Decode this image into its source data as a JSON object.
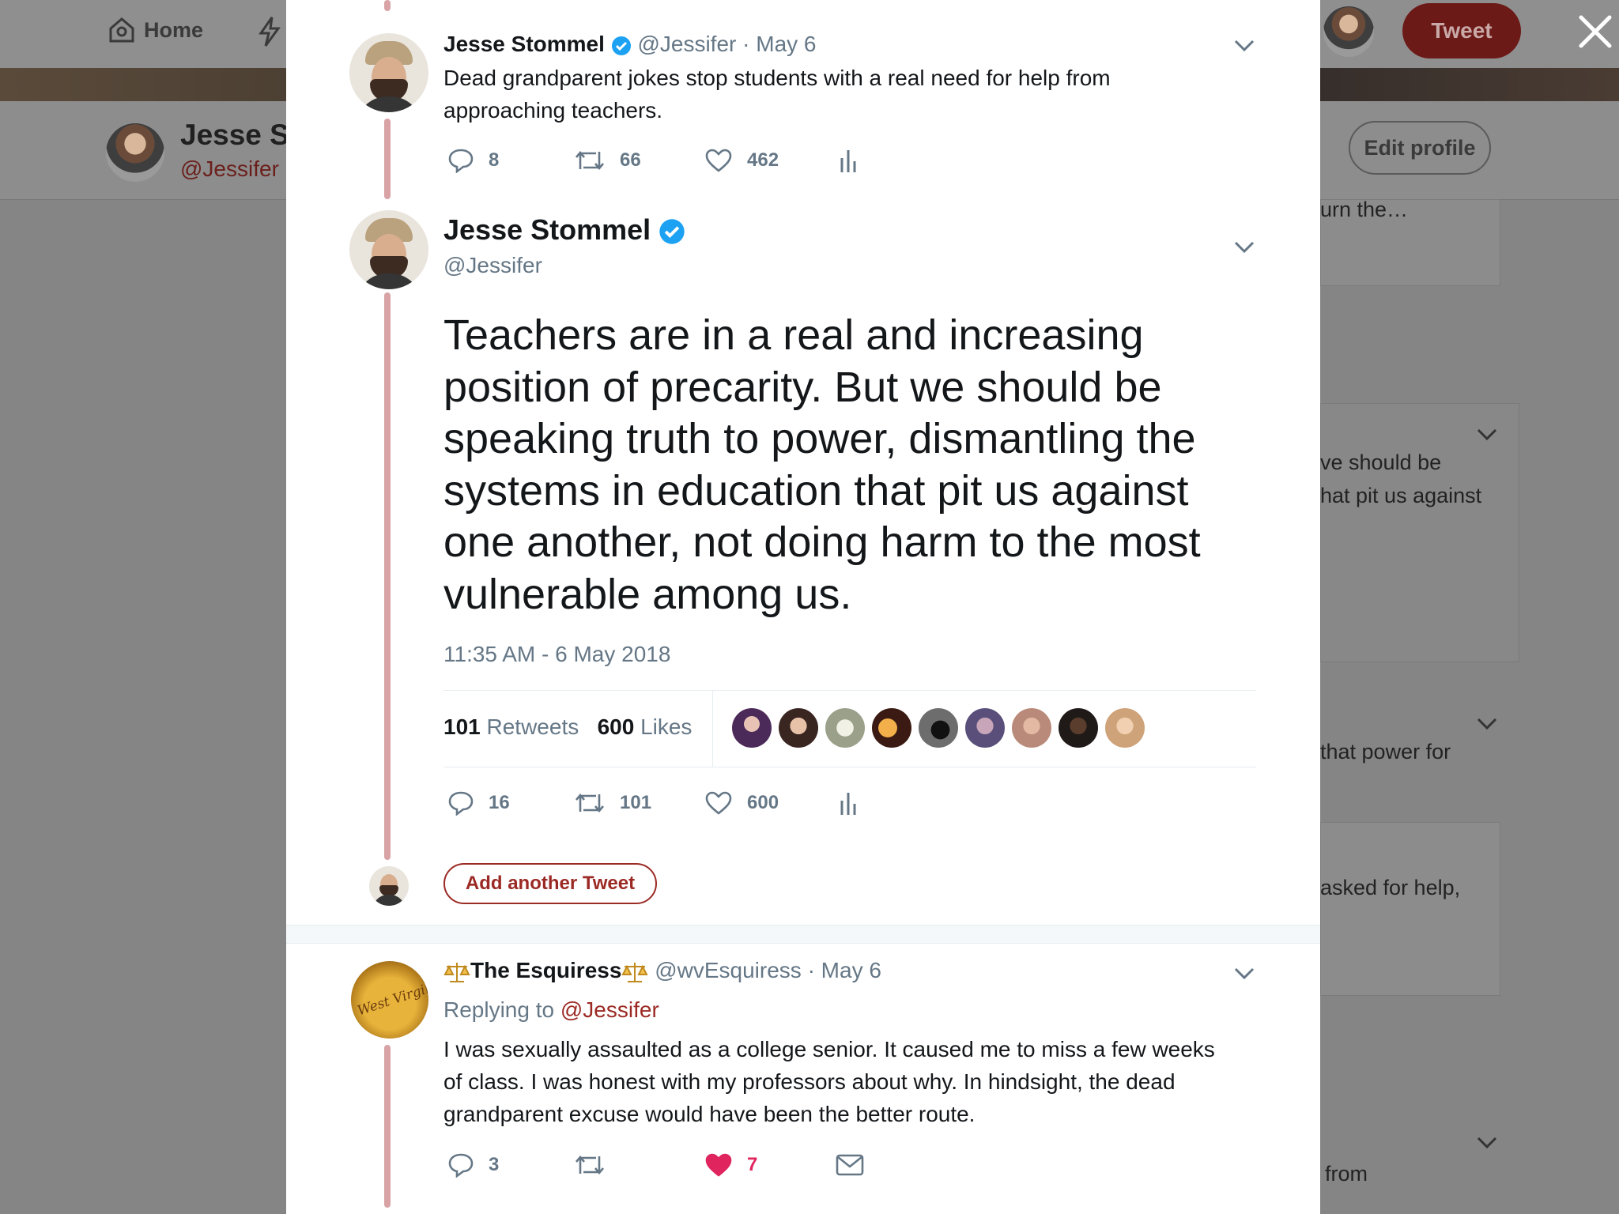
{
  "background": {
    "nav": {
      "home_label": "Home"
    },
    "profile": {
      "name": "Jesse S",
      "handle": "@Jessifer",
      "edit_label": "Edit profile"
    },
    "tweet_button_label": "Tweet",
    "side_snippets": [
      "urn the…",
      "ve should be",
      "hat pit us against",
      "that power for",
      "asked for help,",
      "from"
    ]
  },
  "thread": [
    {
      "name": "Jesse Stommel",
      "handle": "@Jessifer",
      "date": "· May 6",
      "text_lines": [
        "Dead grandparent jokes stop students with a real need for help from",
        "approaching teachers."
      ],
      "replies": "8",
      "retweets": "66",
      "likes": "462"
    }
  ],
  "main_tweet": {
    "name": "Jesse Stommel",
    "handle": "@Jessifer",
    "text_lines": [
      "Teachers are in a real and increasing",
      "position of precarity. But we should be",
      "speaking truth to power, dismantling the",
      "systems in education that pit us against",
      "one another, not doing harm to the most",
      "vulnerable among us."
    ],
    "timestamp": "11:35 AM - 6 May 2018",
    "retweets_count": "101",
    "retweets_label": "Retweets",
    "likes_count": "600",
    "likes_label": "Likes",
    "replies": "16",
    "retweets": "101",
    "likes": "600",
    "add_tweet_label": "Add another Tweet"
  },
  "reply": {
    "name": "The Esquiress",
    "name_prefix_icon": "scales-icon",
    "handle": "@wvEsquiress",
    "date": "· May 6",
    "replying_to_label": "Replying to",
    "replying_to_handle": "@Jessifer",
    "text_lines": [
      "I was sexually assaulted as a college senior. It caused me to miss a few weeks",
      "of class. I was honest with my professors about why. In hindsight, the dead",
      "grandparent excuse would have been the better route."
    ],
    "replies": "3",
    "likes": "7"
  },
  "colors": {
    "accent": "#9b2a24",
    "verified": "#1da1f2",
    "liked": "#e0245e",
    "thread_line": "#d9a3a6"
  }
}
